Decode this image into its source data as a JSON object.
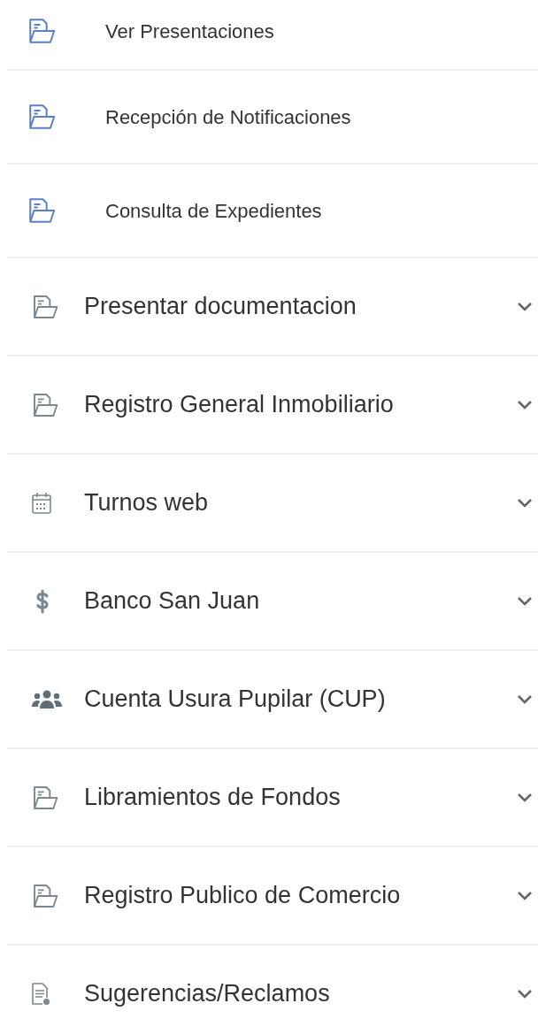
{
  "menu": {
    "items": [
      {
        "kind": "link",
        "label": "Ver Presentaciones"
      },
      {
        "kind": "link",
        "label": "Recepción de Notificaciones"
      },
      {
        "kind": "link",
        "label": "Consulta de Expedientes"
      },
      {
        "kind": "section",
        "label": "Presentar documentacion",
        "expanded": false
      },
      {
        "kind": "section",
        "label": "Registro General Inmobiliario",
        "expanded": false
      },
      {
        "kind": "section",
        "label": "Turnos web",
        "expanded": false
      },
      {
        "kind": "section",
        "label": "Banco San Juan",
        "expanded": false
      },
      {
        "kind": "section",
        "label": "Cuenta Usura Pupilar (CUP)",
        "expanded": false
      },
      {
        "kind": "section",
        "label": "Libramientos de Fondos",
        "expanded": false
      },
      {
        "kind": "section",
        "label": "Registro Publico de Comercio",
        "expanded": false
      },
      {
        "kind": "section",
        "label": "Sugerencias/Reclamos",
        "expanded": false
      }
    ]
  }
}
